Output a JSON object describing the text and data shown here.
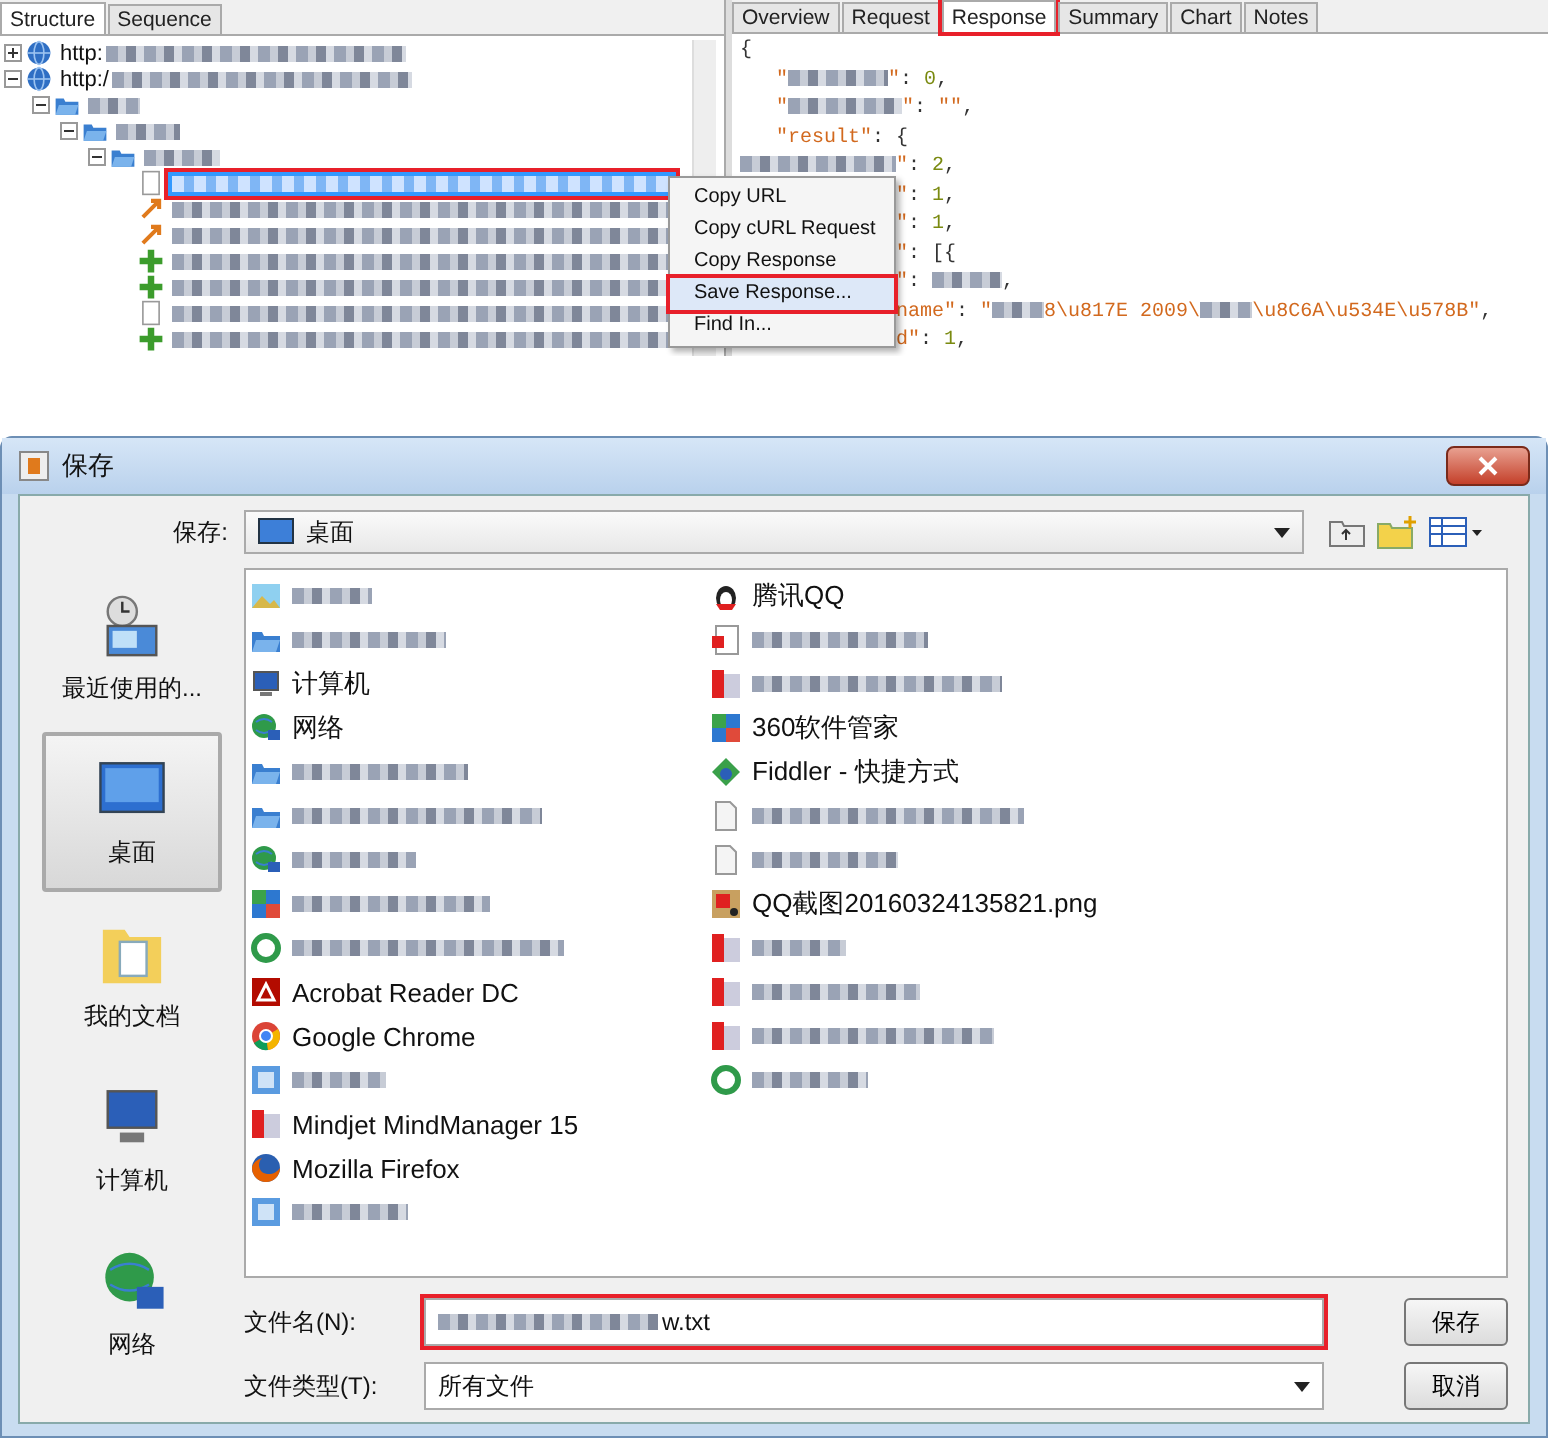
{
  "fiddler": {
    "left_tabs": [
      {
        "label": "Structure",
        "selected": true
      },
      {
        "label": "Sequence",
        "selected": false
      }
    ],
    "tree": [
      {
        "label": "http:",
        "kind": "host",
        "expanded": false
      },
      {
        "label": "http:/",
        "kind": "host",
        "expanded": true,
        "children": [
          {
            "kind": "folder",
            "expanded": true,
            "children": [
              {
                "kind": "folder",
                "expanded": true,
                "children": [
                  {
                    "kind": "folder",
                    "expanded": true,
                    "children": [
                      {
                        "kind": "page",
                        "selected": true,
                        "annotated": true
                      },
                      {
                        "kind": "redirect",
                        "selected": false,
                        "annotated": false
                      },
                      {
                        "kind": "redirect",
                        "selected": false,
                        "annotated": false
                      },
                      {
                        "kind": "success",
                        "selected": false,
                        "annotated": false
                      },
                      {
                        "kind": "success",
                        "selected": false,
                        "annotated": false
                      },
                      {
                        "kind": "page",
                        "selected": false,
                        "annotated": false
                      },
                      {
                        "kind": "success",
                        "selected": false,
                        "annotated": false
                      }
                    ]
                  }
                ]
              }
            ]
          }
        ]
      }
    ],
    "right_tabs": [
      {
        "label": "Overview",
        "selected": false,
        "annotated": false
      },
      {
        "label": "Request",
        "selected": false,
        "annotated": false
      },
      {
        "label": "Response",
        "selected": true,
        "annotated": true
      },
      {
        "label": "Summary",
        "selected": false,
        "annotated": false
      },
      {
        "label": "Chart",
        "selected": false,
        "annotated": false
      },
      {
        "label": "Notes",
        "selected": false,
        "annotated": false
      }
    ],
    "response_lines": [
      [
        {
          "kind": "p",
          "text": "{"
        }
      ],
      [
        {
          "kind": "str",
          "text": "   \""
        },
        {
          "kind": "blur"
        },
        {
          "kind": "str",
          "text": "\""
        },
        {
          "kind": "p",
          "text": ": "
        },
        {
          "kind": "num",
          "text": "0"
        },
        {
          "kind": "p",
          "text": ","
        }
      ],
      [
        {
          "kind": "str",
          "text": "   \""
        },
        {
          "kind": "blur"
        },
        {
          "kind": "str",
          "text": "\""
        },
        {
          "kind": "p",
          "text": ": "
        },
        {
          "kind": "str",
          "text": "\"\""
        },
        {
          "kind": "p",
          "text": ","
        }
      ],
      [
        {
          "kind": "str",
          "text": "   \"result\""
        },
        {
          "kind": "p",
          "text": ": {"
        }
      ],
      [
        {
          "kind": "blur"
        },
        {
          "kind": "str",
          "text": "\""
        },
        {
          "kind": "p",
          "text": ": "
        },
        {
          "kind": "num",
          "text": "2"
        },
        {
          "kind": "p",
          "text": ","
        }
      ],
      [
        {
          "kind": "blur"
        },
        {
          "kind": "str",
          "text": "\""
        },
        {
          "kind": "p",
          "text": ": "
        },
        {
          "kind": "num",
          "text": "1"
        },
        {
          "kind": "p",
          "text": ","
        }
      ],
      [
        {
          "kind": "blur"
        },
        {
          "kind": "str",
          "text": "\""
        },
        {
          "kind": "p",
          "text": ": "
        },
        {
          "kind": "num",
          "text": "1"
        },
        {
          "kind": "p",
          "text": ","
        }
      ],
      [
        {
          "kind": "blur"
        },
        {
          "kind": "str",
          "text": "\""
        },
        {
          "kind": "p",
          "text": ": [{"
        }
      ],
      [
        {
          "kind": "blur"
        },
        {
          "kind": "str",
          "text": "\""
        },
        {
          "kind": "p",
          "text": ": "
        },
        {
          "kind": "blur"
        },
        {
          "kind": "p",
          "text": ","
        }
      ],
      [
        {
          "kind": "blur"
        },
        {
          "kind": "str",
          "text": "name\""
        },
        {
          "kind": "p",
          "text": ": "
        },
        {
          "kind": "str",
          "text": "\""
        },
        {
          "kind": "blur"
        },
        {
          "kind": "str",
          "text": "8\\u817E 2009\\"
        },
        {
          "kind": "blur"
        },
        {
          "kind": "str",
          "text": "\\u8C6A\\u534E\\u578B\""
        },
        {
          "kind": "p",
          "text": ","
        }
      ],
      [
        {
          "kind": "blur"
        },
        {
          "kind": "str",
          "text": "d\""
        },
        {
          "kind": "p",
          "text": ": "
        },
        {
          "kind": "num",
          "text": "1"
        },
        {
          "kind": "p",
          "text": ","
        }
      ]
    ],
    "context_menu": [
      {
        "label": "Copy URL",
        "selected": false,
        "annotated": false
      },
      {
        "label": "Copy cURL Request",
        "selected": false,
        "annotated": false
      },
      {
        "label": "Copy Response",
        "selected": false,
        "annotated": false
      },
      {
        "label": "Save Response...",
        "selected": true,
        "annotated": true
      },
      {
        "label": "Find In...",
        "selected": false,
        "annotated": false
      }
    ]
  },
  "save_dialog": {
    "title": "保存",
    "save_in_label": "保存:",
    "save_in_value": "桌面",
    "places": [
      {
        "label": "最近使用的...",
        "selected": false
      },
      {
        "label": "桌面",
        "selected": true
      },
      {
        "label": "我的文档",
        "selected": false
      },
      {
        "label": "计算机",
        "selected": false
      },
      {
        "label": "网络",
        "selected": false
      }
    ],
    "file_columns": [
      {
        "items": [
          {
            "kind": "image",
            "redacted": true
          },
          {
            "kind": "folder",
            "redacted": true
          },
          {
            "kind": "computer",
            "label": "计算机"
          },
          {
            "kind": "network",
            "label": "网络"
          },
          {
            "kind": "folder",
            "redacted": true
          },
          {
            "kind": "folder",
            "redacted": true
          },
          {
            "kind": "network",
            "redacted": true
          },
          {
            "kind": "tiles",
            "redacted": true
          },
          {
            "kind": "ring",
            "redacted": true
          },
          {
            "kind": "acrobat",
            "label": "Acrobat Reader DC"
          },
          {
            "kind": "chrome",
            "label": "Google Chrome"
          },
          {
            "kind": "app",
            "redacted": true
          },
          {
            "kind": "strip",
            "label": "Mindjet MindManager 15"
          },
          {
            "kind": "firefox",
            "label": "Mozilla Firefox"
          },
          {
            "kind": "app",
            "redacted": true
          }
        ]
      },
      {
        "items": [
          {
            "kind": "qq",
            "label": "腾讯QQ"
          },
          {
            "kind": "pdf",
            "redacted": true
          },
          {
            "kind": "strip",
            "redacted": true
          },
          {
            "kind": "tiles",
            "label": "360软件管家"
          },
          {
            "kind": "shortcut",
            "label": "Fiddler - 快捷方式"
          },
          {
            "kind": "doc",
            "redacted": true
          },
          {
            "kind": "doc",
            "redacted": true
          },
          {
            "kind": "picture",
            "label": "QQ截图20160324135821.png"
          },
          {
            "kind": "strip",
            "redacted": true
          },
          {
            "kind": "strip",
            "redacted": true
          },
          {
            "kind": "strip",
            "redacted": true
          },
          {
            "kind": "ring",
            "redacted": true
          }
        ]
      }
    ],
    "filename": {
      "label": "文件名(N):",
      "value": "w.txt",
      "redacted_prefix": true,
      "annotated": true
    },
    "filetype": {
      "label": "文件类型(T):",
      "value": "所有文件"
    },
    "buttons": [
      {
        "label": "保存"
      },
      {
        "label": "取消"
      }
    ]
  }
}
